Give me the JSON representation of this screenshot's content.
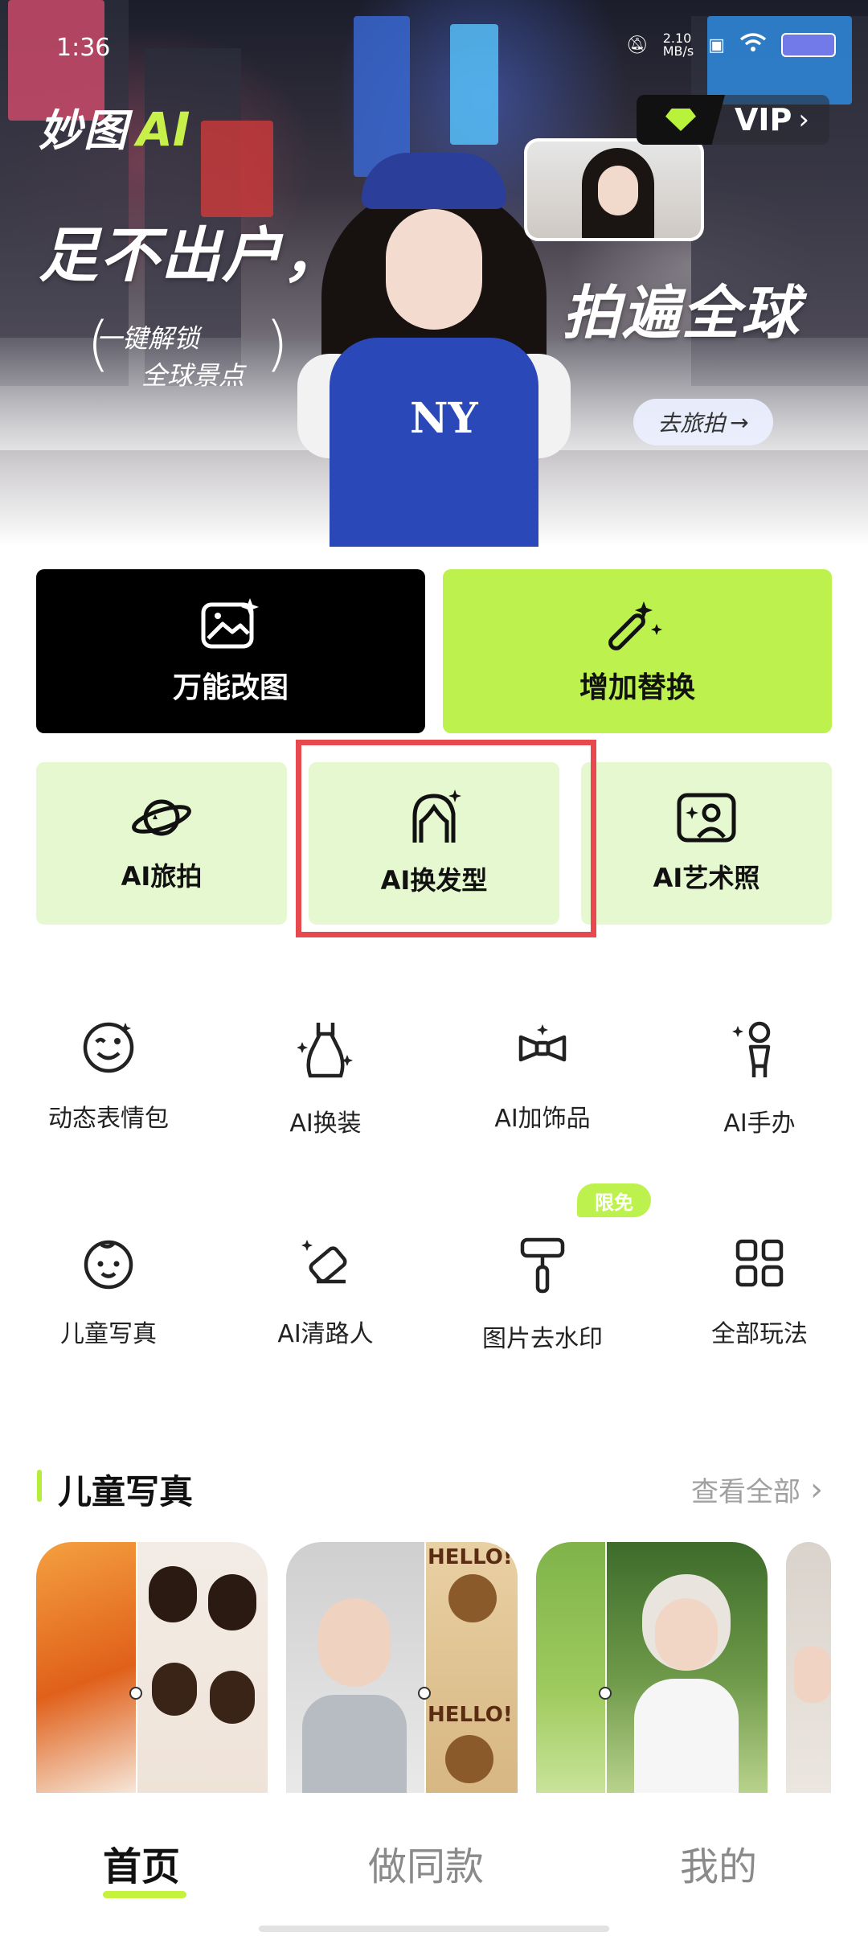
{
  "status_bar": {
    "time": "1:36",
    "net_speed": "2.10\nMB/s"
  },
  "brand": {
    "name_cn": "妙图",
    "name_ai": "AI"
  },
  "vip": {
    "label": "VIP",
    "chevron": "›"
  },
  "hero": {
    "title_left": "足不出户，",
    "title_right": "拍遍全球",
    "sub_line1": "一键解锁",
    "sub_line2": "全球景点",
    "cta": "去旅拍",
    "cta_arrow": "→"
  },
  "big_cards": [
    {
      "label": "万能改图",
      "icon": "image-sparkle-icon"
    },
    {
      "label": "增加替换",
      "icon": "magic-wand-icon"
    }
  ],
  "mid_cards": [
    {
      "label": "AI旅拍",
      "icon": "planet-icon"
    },
    {
      "label": "AI换发型",
      "icon": "hair-icon"
    },
    {
      "label": "AI艺术照",
      "icon": "portrait-frame-icon"
    }
  ],
  "tools": [
    {
      "label": "动态表情包",
      "icon": "wink-emoji-icon"
    },
    {
      "label": "AI换装",
      "icon": "dress-icon"
    },
    {
      "label": "AI加饰品",
      "icon": "bowtie-icon"
    },
    {
      "label": "AI手办",
      "icon": "figurine-icon"
    },
    {
      "label": "儿童写真",
      "icon": "baby-face-icon"
    },
    {
      "label": "AI清路人",
      "icon": "eraser-icon"
    },
    {
      "label": "图片去水印",
      "icon": "paint-roller-icon"
    },
    {
      "label": "全部玩法",
      "icon": "grid-icon"
    }
  ],
  "free_badge": "限免",
  "section": {
    "title": "儿童写真",
    "more": "查看全部",
    "more_chevron": "›"
  },
  "photo_overlay_text": "HELLO!",
  "bottom_nav": [
    {
      "label": "首页",
      "active": true
    },
    {
      "label": "做同款",
      "active": false
    },
    {
      "label": "我的",
      "active": false
    }
  ],
  "colors": {
    "accent_lime": "#bdf24e",
    "highlight_red": "#e8494f",
    "card_light": "#e6f8cf"
  }
}
